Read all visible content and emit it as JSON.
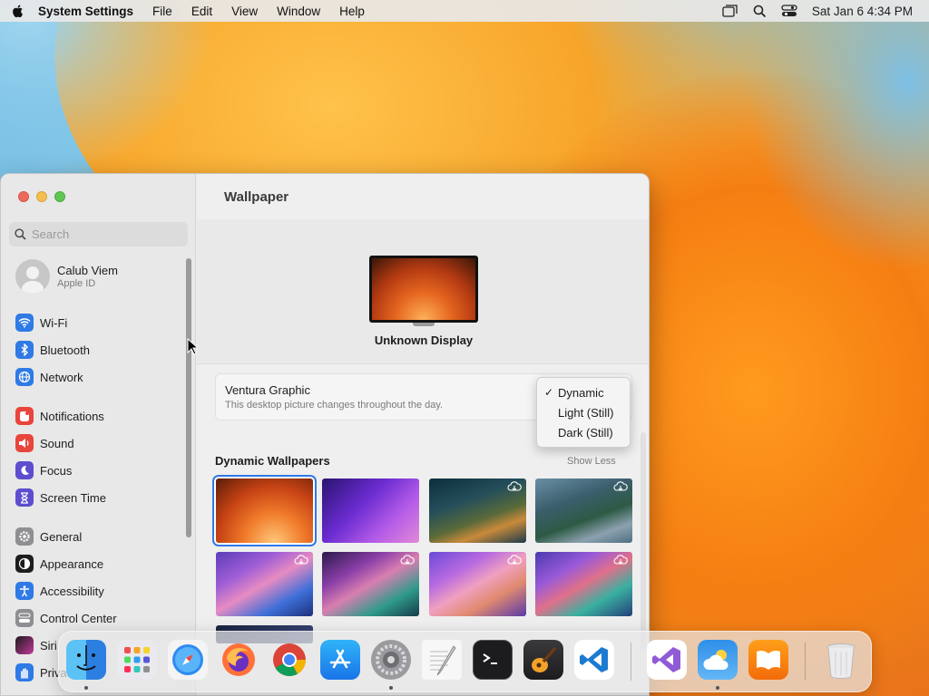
{
  "menubar": {
    "apple_icon": "apple-logo-icon",
    "app_name": "System Settings",
    "menus": [
      "File",
      "Edit",
      "View",
      "Window",
      "Help"
    ],
    "status_icons": [
      "stage-manager-icon",
      "spotlight-search-icon",
      "control-center-icon"
    ],
    "clock": "Sat Jan 6  4:34 PM"
  },
  "sidebar": {
    "search_placeholder": "Search",
    "user": {
      "name": "Calub Viem",
      "subtitle": "Apple ID"
    },
    "items": [
      {
        "label": "Wi-Fi",
        "icon": "wifi-icon",
        "color": "#2f7ae5"
      },
      {
        "label": "Bluetooth",
        "icon": "bluetooth-icon",
        "color": "#2f7ae5"
      },
      {
        "label": "Network",
        "icon": "globe-icon",
        "color": "#2f7ae5"
      },
      {
        "label": "Notifications",
        "icon": "bell-icon",
        "color": "#e8453c"
      },
      {
        "label": "Sound",
        "icon": "speaker-icon",
        "color": "#e8453c"
      },
      {
        "label": "Focus",
        "icon": "moon-icon",
        "color": "#5d4ecf"
      },
      {
        "label": "Screen Time",
        "icon": "hourglass-icon",
        "color": "#5d4ecf"
      },
      {
        "label": "General",
        "icon": "gear-icon",
        "color": "#8e8e93"
      },
      {
        "label": "Appearance",
        "icon": "appearance-icon",
        "color": "#1d1d1f"
      },
      {
        "label": "Accessibility",
        "icon": "accessibility-icon",
        "color": "#2f7ae5"
      },
      {
        "label": "Control Center",
        "icon": "control-center-icon",
        "color": "#8e8e93"
      },
      {
        "label": "Siri",
        "icon": "siri-icon",
        "color": "#c4389a"
      },
      {
        "label": "Privacy",
        "icon": "hand-icon",
        "color": "#2f7ae5"
      }
    ]
  },
  "content": {
    "title": "Wallpaper",
    "display_name": "Unknown Display",
    "wallpaper_name": "Ventura Graphic",
    "wallpaper_desc": "This desktop picture changes throughout the day.",
    "dropdown": {
      "selected": "Dynamic",
      "options": [
        "Dynamic",
        "Light (Still)",
        "Dark (Still)"
      ]
    },
    "section_title": "Dynamic Wallpapers",
    "show_less": "Show Less",
    "thumbnails": [
      {
        "name": "Ventura Graphic",
        "selected": true,
        "download": false
      },
      {
        "name": "Purple Graphic",
        "selected": false,
        "download": false
      },
      {
        "name": "Catalina Coast Night",
        "selected": false,
        "download": true
      },
      {
        "name": "Catalina Coast Day",
        "selected": false,
        "download": true
      },
      {
        "name": "Big Sur Colorful 1",
        "selected": false,
        "download": true
      },
      {
        "name": "Big Sur Colorful 2",
        "selected": false,
        "download": true
      },
      {
        "name": "Big Sur Colorful 3",
        "selected": false,
        "download": true
      },
      {
        "name": "Big Sur Colorful 4",
        "selected": false,
        "download": true
      }
    ]
  },
  "dock": {
    "apps": [
      {
        "name": "Finder",
        "icon": "finder-icon",
        "running": true
      },
      {
        "name": "Launchpad",
        "icon": "launchpad-icon",
        "running": false
      },
      {
        "name": "Safari",
        "icon": "safari-icon",
        "running": false
      },
      {
        "name": "Firefox",
        "icon": "firefox-icon",
        "running": false
      },
      {
        "name": "Google Chrome",
        "icon": "chrome-icon",
        "running": false
      },
      {
        "name": "App Store",
        "icon": "app-store-icon",
        "running": false
      },
      {
        "name": "System Settings",
        "icon": "system-settings-icon",
        "running": true
      },
      {
        "name": "TextEdit",
        "icon": "textedit-icon",
        "running": false
      },
      {
        "name": "Terminal",
        "icon": "terminal-icon",
        "running": false
      },
      {
        "name": "GarageBand",
        "icon": "garageband-icon",
        "running": false
      },
      {
        "name": "Visual Studio Code",
        "icon": "vscode-icon",
        "running": false
      },
      {
        "name": "Visual Studio",
        "icon": "visual-studio-icon",
        "running": false
      },
      {
        "name": "Weather",
        "icon": "weather-icon",
        "running": true
      },
      {
        "name": "Books",
        "icon": "books-icon",
        "running": false
      },
      {
        "name": "Trash",
        "icon": "trash-icon",
        "running": false
      }
    ]
  }
}
